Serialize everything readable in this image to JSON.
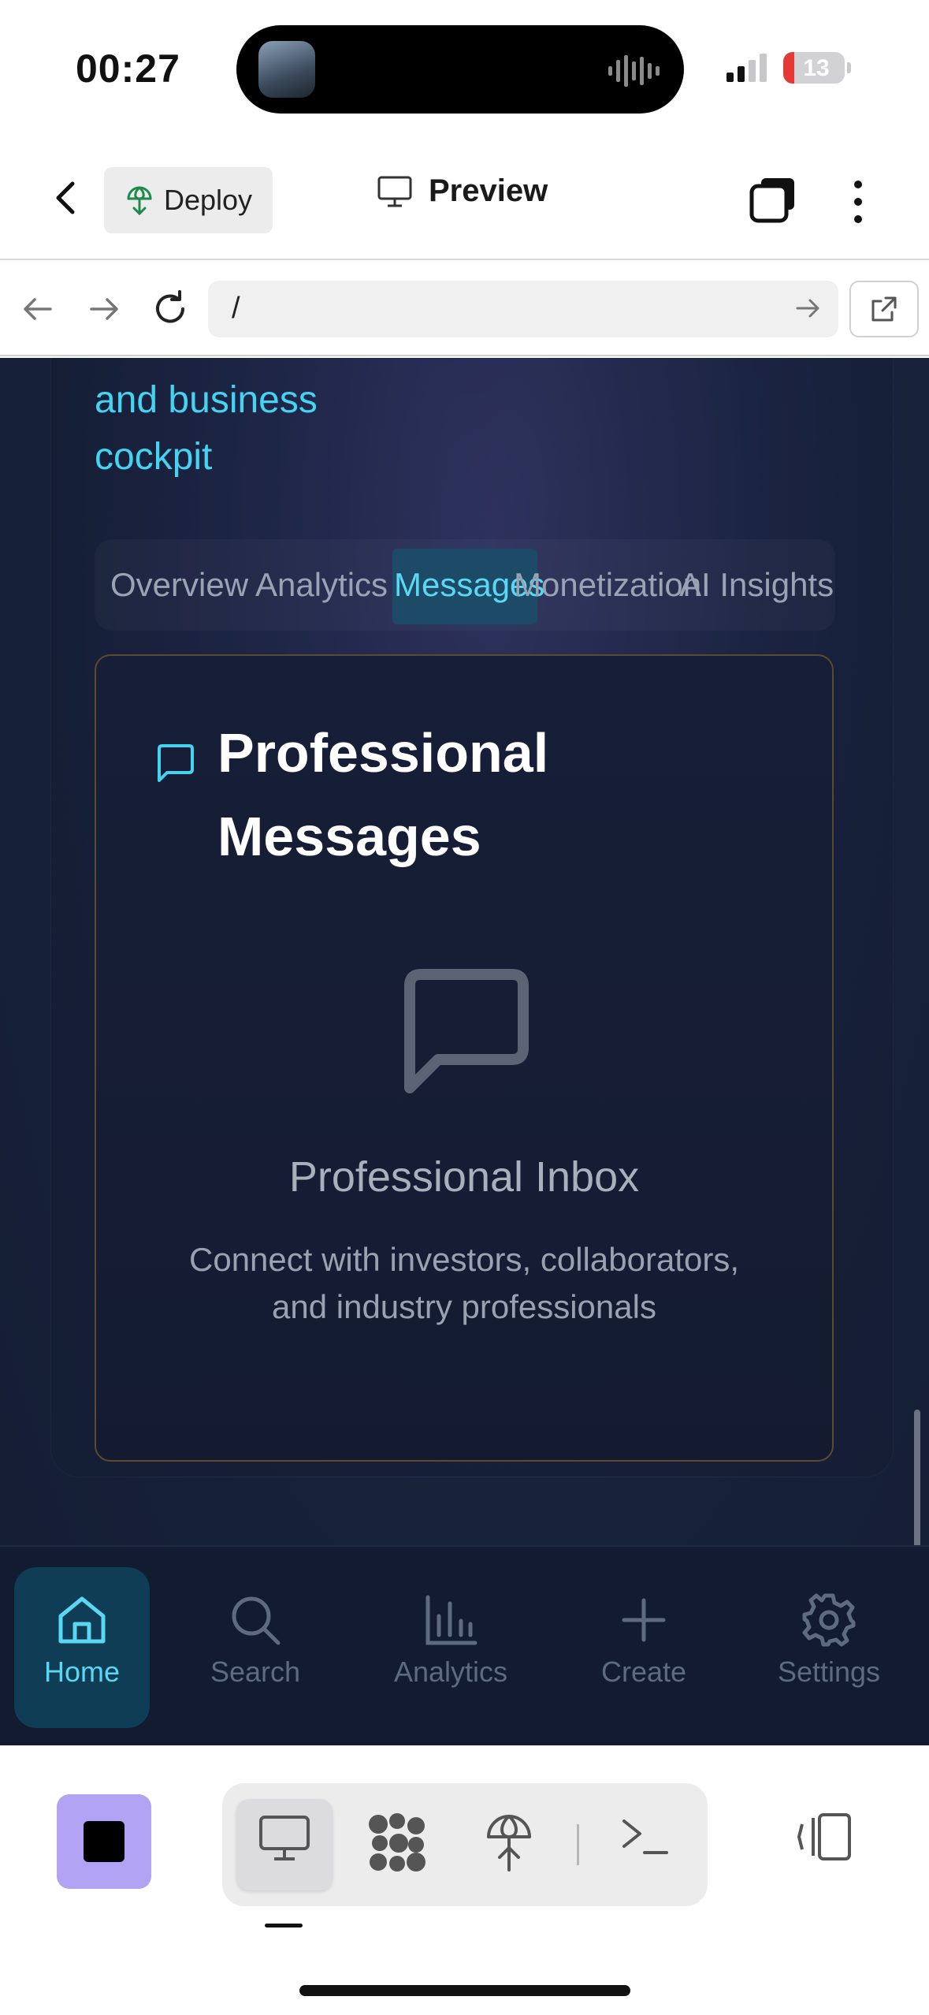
{
  "status_bar": {
    "time": "00:27",
    "battery": "13"
  },
  "app_header": {
    "deploy_label": "Deploy",
    "preview_label": "Preview"
  },
  "url_bar": {
    "url": "/"
  },
  "web": {
    "hero_line1": "and business",
    "hero_line2": "cockpit",
    "tabs": [
      {
        "label": "Overview"
      },
      {
        "label": "Analytics"
      },
      {
        "label": "Messages",
        "active": true
      },
      {
        "label": "Monetization"
      },
      {
        "label": "AI Insights"
      }
    ],
    "card": {
      "title": "Professional Messages",
      "empty_title": "Professional Inbox",
      "empty_desc_line1": "Connect with investors, collaborators,",
      "empty_desc_line2": "and industry professionals"
    },
    "bottom_nav": [
      {
        "label": "Home",
        "icon": "home-icon",
        "active": true
      },
      {
        "label": "Search",
        "icon": "search-icon"
      },
      {
        "label": "Analytics",
        "icon": "bar-chart-icon"
      },
      {
        "label": "Create",
        "icon": "plus-icon"
      },
      {
        "label": "Settings",
        "icon": "gear-icon"
      }
    ]
  },
  "colors": {
    "accent": "#44d3f0",
    "active_nav_bg": "#0f3d55",
    "stop_button": "#b3a3f5",
    "card_border": "#5b4a2e"
  }
}
